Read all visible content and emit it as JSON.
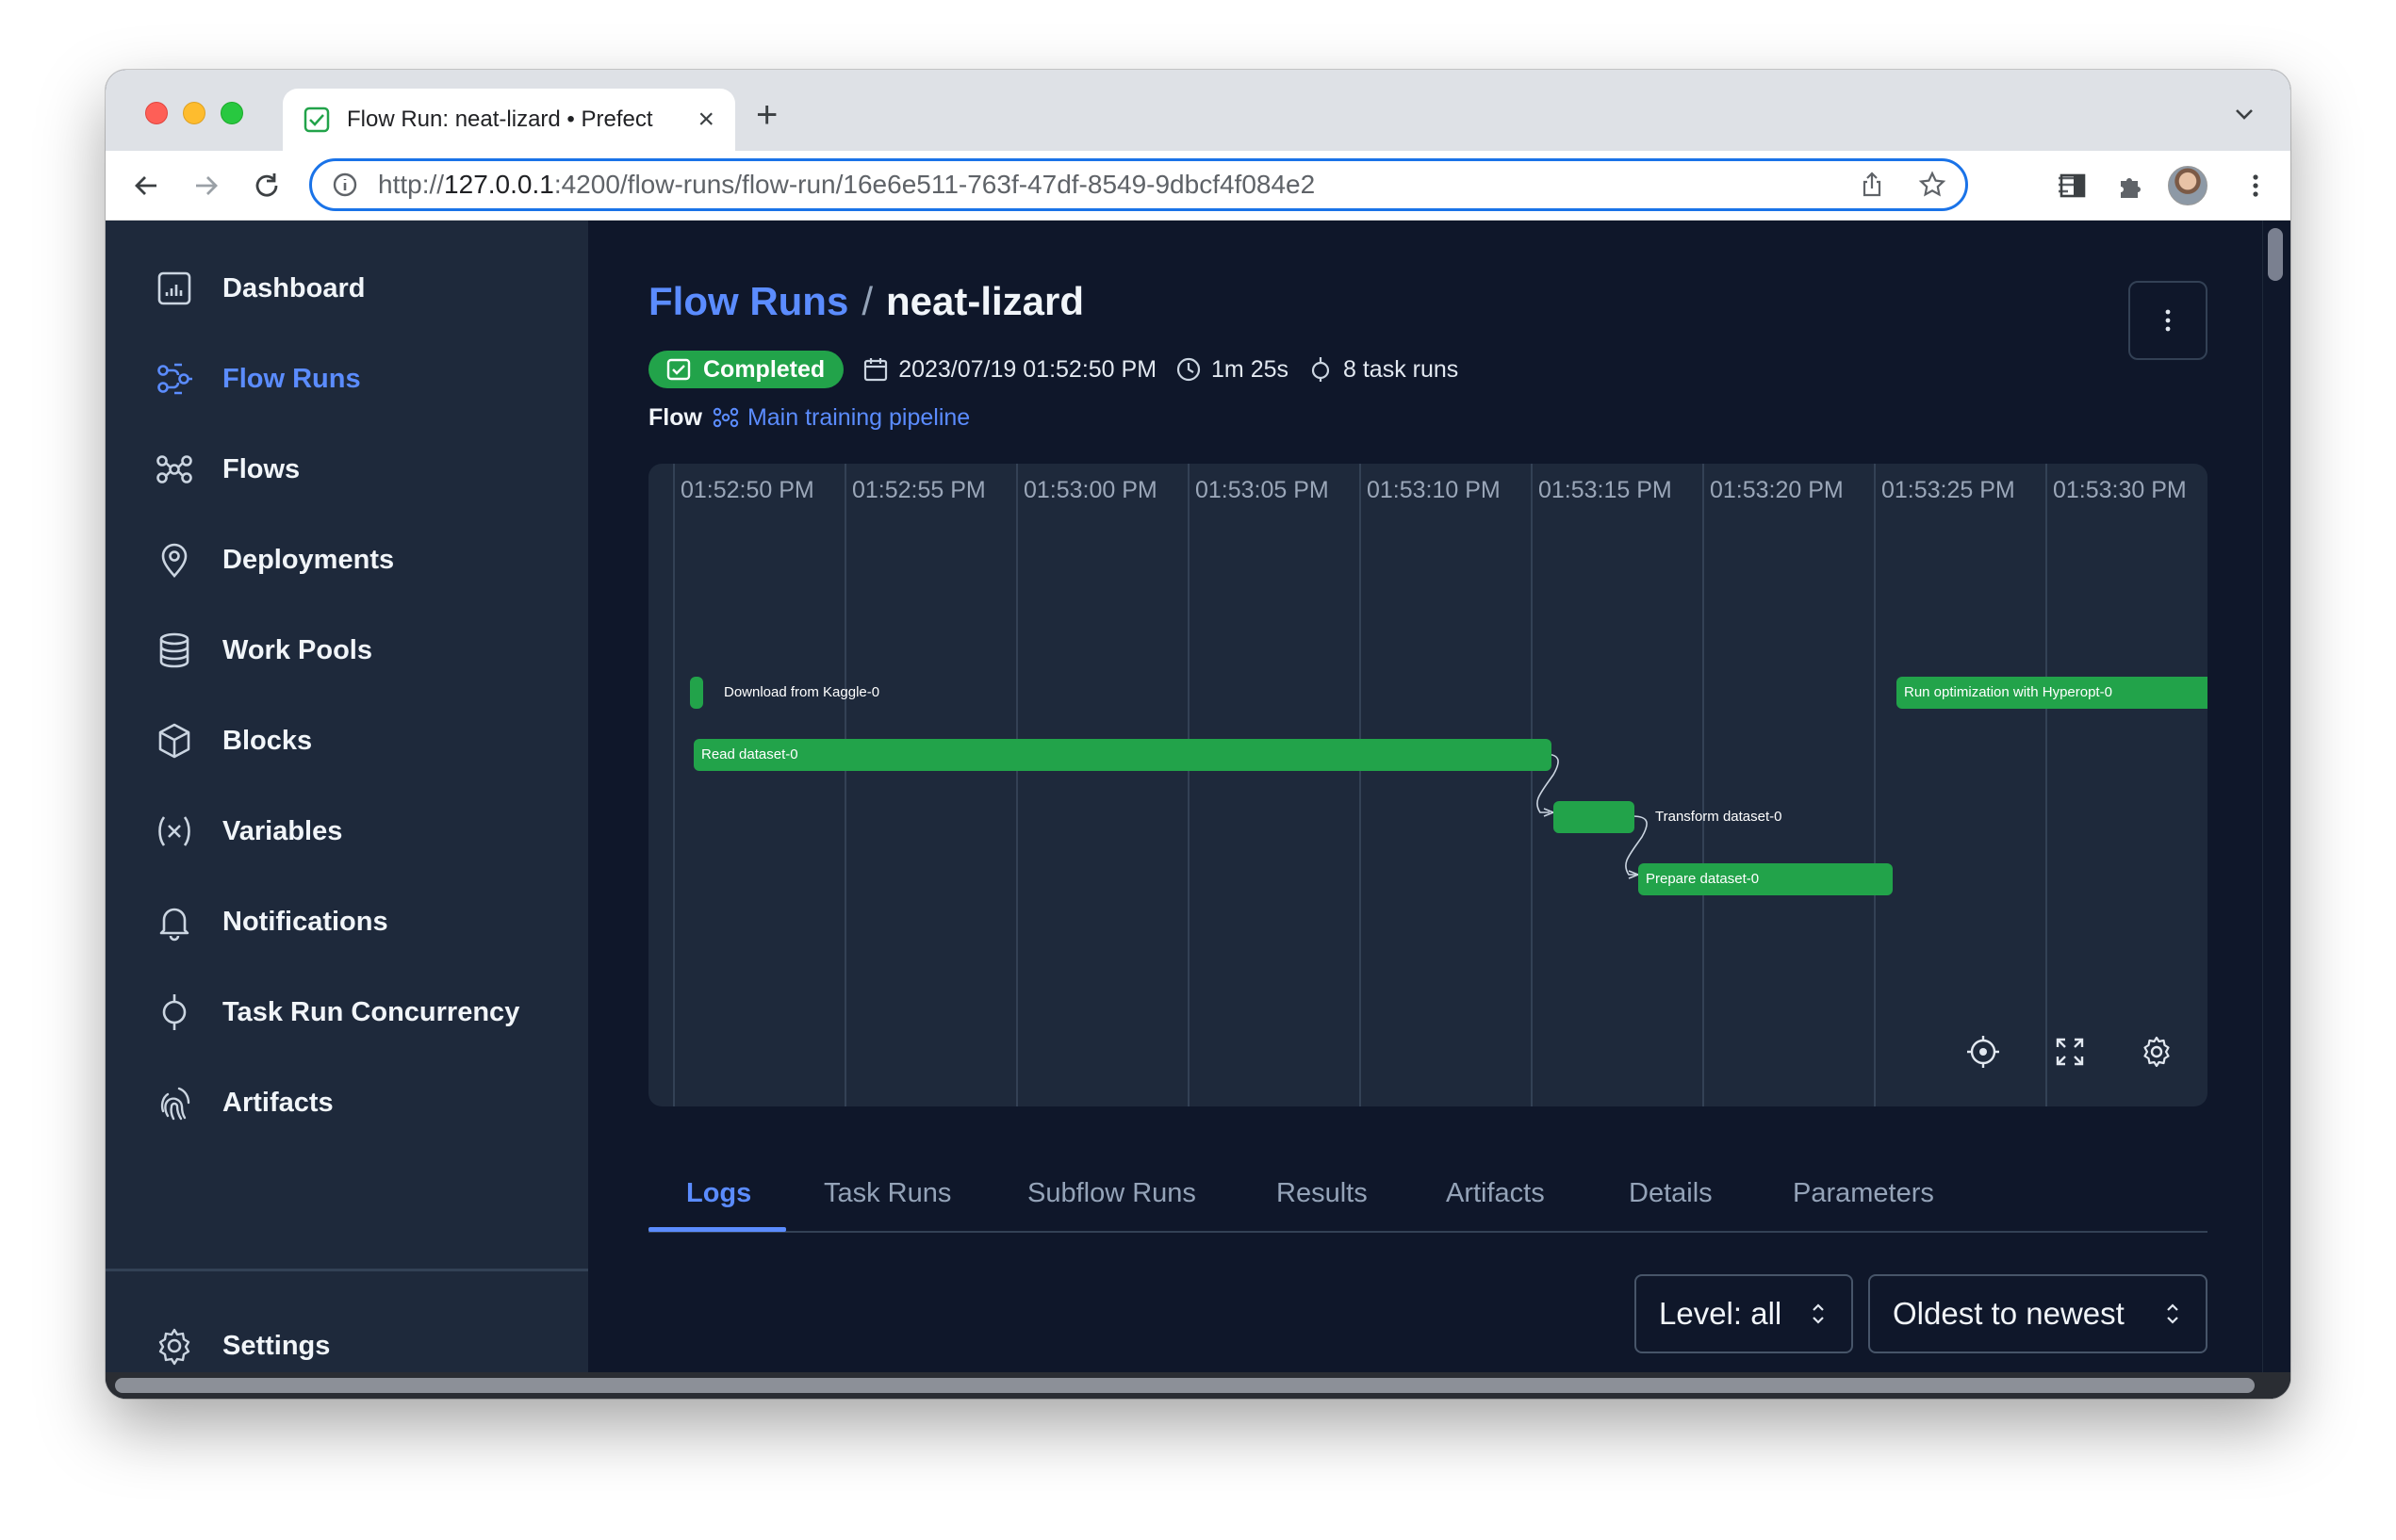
{
  "browser": {
    "tab_title": "Flow Run: neat-lizard • Prefect",
    "url_scheme": "http://",
    "url_host": "127.0.0.1",
    "url_rest": ":4200/flow-runs/flow-run/16e6e511-763f-47df-8549-9dbcf4f084e2"
  },
  "sidebar": {
    "items": [
      {
        "label": "Dashboard",
        "icon": "chart-icon"
      },
      {
        "label": "Flow Runs",
        "icon": "flow-runs-icon",
        "active": true
      },
      {
        "label": "Flows",
        "icon": "flows-icon"
      },
      {
        "label": "Deployments",
        "icon": "map-pin-icon"
      },
      {
        "label": "Work Pools",
        "icon": "database-icon"
      },
      {
        "label": "Blocks",
        "icon": "cube-icon"
      },
      {
        "label": "Variables",
        "icon": "variable-icon"
      },
      {
        "label": "Notifications",
        "icon": "bell-icon"
      },
      {
        "label": "Task Run Concurrency",
        "icon": "concurrency-icon"
      },
      {
        "label": "Artifacts",
        "icon": "fingerprint-icon"
      }
    ],
    "settings_label": "Settings"
  },
  "header": {
    "breadcrumb_link": "Flow Runs",
    "separator": "/",
    "run_name": "neat-lizard"
  },
  "meta": {
    "state": "Completed",
    "start_time": "2023/07/19 01:52:50 PM",
    "duration": "1m 25s",
    "task_runs": "8 task runs",
    "flow_label": "Flow",
    "flow_name": "Main training pipeline"
  },
  "colors": {
    "accent": "#5b8cff",
    "success": "#22a34a",
    "sidebar_bg": "#1e293b",
    "main_bg": "#0f172a"
  },
  "timeline": {
    "time_labels": [
      "01:52:50 PM",
      "01:52:55 PM",
      "01:53:00 PM",
      "01:53:05 PM",
      "01:53:10 PM",
      "01:53:15 PM",
      "01:53:20 PM",
      "01:53:25 PM",
      "01:53:30 PM"
    ],
    "task_bars": [
      {
        "label": "Download from Kaggle-0"
      },
      {
        "label": "Read dataset-0"
      },
      {
        "label": "Transform dataset-0"
      },
      {
        "label": "Prepare dataset-0"
      },
      {
        "label": "Run optimization with Hyperopt-0"
      }
    ]
  },
  "tabs": [
    "Logs",
    "Task Runs",
    "Subflow Runs",
    "Results",
    "Artifacts",
    "Details",
    "Parameters"
  ],
  "filters": {
    "level": "Level: all",
    "sort": "Oldest to newest"
  }
}
